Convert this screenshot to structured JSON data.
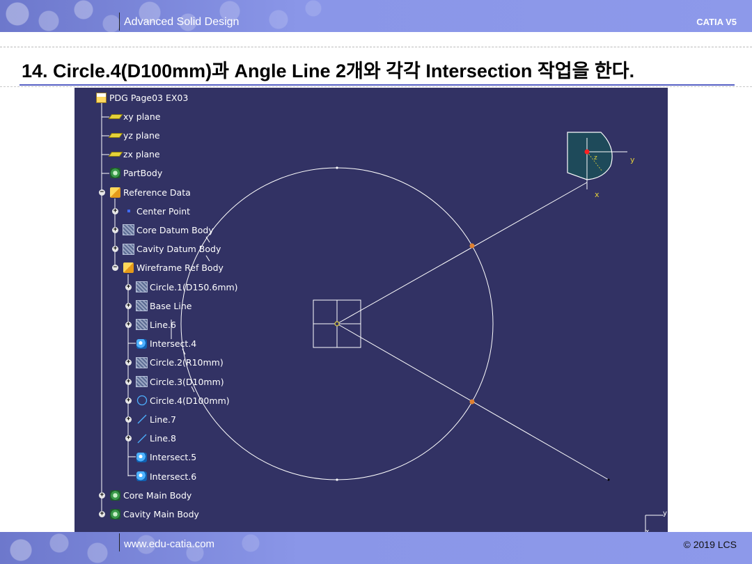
{
  "header": {
    "course": "Advanced Solid Design",
    "brand": "CATIA V5"
  },
  "slide": {
    "title": "14. Circle.4(D100mm)과 Angle Line 2개와 각각 Intersection 작업을 한다."
  },
  "tree": [
    {
      "label": "PDG Page03 EX03",
      "icon": "root-product-icon",
      "expander": "none"
    },
    {
      "label": "xy plane",
      "icon": "plane-icon",
      "expander": "none"
    },
    {
      "label": "yz plane",
      "icon": "plane-icon",
      "expander": "none"
    },
    {
      "label": "zx plane",
      "icon": "plane-icon",
      "expander": "none"
    },
    {
      "label": "PartBody",
      "icon": "partbody-gear-icon",
      "expander": "none"
    },
    {
      "label": "Reference Data",
      "icon": "geometrical-set-icon",
      "expander": "-"
    },
    {
      "label": "Center Point",
      "icon": "point-icon",
      "expander": "+"
    },
    {
      "label": "Core Datum Body",
      "icon": "datum-body-icon",
      "expander": "+"
    },
    {
      "label": "Cavity Datum Body",
      "icon": "datum-body-icon",
      "expander": "+"
    },
    {
      "label": "Wireframe Ref Body",
      "icon": "geometrical-set-icon",
      "expander": "-"
    },
    {
      "label": "Circle.1(D150.6mm)",
      "icon": "circle-feature-icon",
      "expander": "+"
    },
    {
      "label": "Base Line",
      "icon": "line-feature-icon",
      "expander": "+"
    },
    {
      "label": "Line.6",
      "icon": "line-feature-icon",
      "expander": "+"
    },
    {
      "label": "Intersect.4",
      "icon": "intersect-icon",
      "expander": "none"
    },
    {
      "label": "Circle.2(R10mm)",
      "icon": "circle-feature-icon",
      "expander": "+"
    },
    {
      "label": "Circle.3(D10mm)",
      "icon": "circle-feature-icon",
      "expander": "+"
    },
    {
      "label": "Circle.4(D100mm)",
      "icon": "circle-outline-icon",
      "expander": "+"
    },
    {
      "label": "Line.7",
      "icon": "line-icon",
      "expander": "+"
    },
    {
      "label": "Line.8",
      "icon": "line-icon",
      "expander": "+"
    },
    {
      "label": "Intersect.5",
      "icon": "intersect-icon",
      "expander": "none"
    },
    {
      "label": "Intersect.6",
      "icon": "intersect-icon",
      "expander": "none"
    },
    {
      "label": "Core Main Body",
      "icon": "body-icon",
      "expander": "+"
    },
    {
      "label": "Cavity Main Body",
      "icon": "body-icon",
      "expander": "+"
    }
  ],
  "axis_labels": {
    "y": "y",
    "z": "z",
    "x": "x"
  },
  "compass_axis": {
    "y": "y",
    "x": "x"
  },
  "colors": {
    "viewport_bg": "#323264",
    "geometry": "#ffffff",
    "intersect_point": "#e08030",
    "axis_yellow": "#e5d23a",
    "origin_red": "#ff2020",
    "header_blue": "#8a96e8"
  },
  "footer": {
    "site": "www.edu-catia.com",
    "copyright": "© 2019 LCS"
  }
}
